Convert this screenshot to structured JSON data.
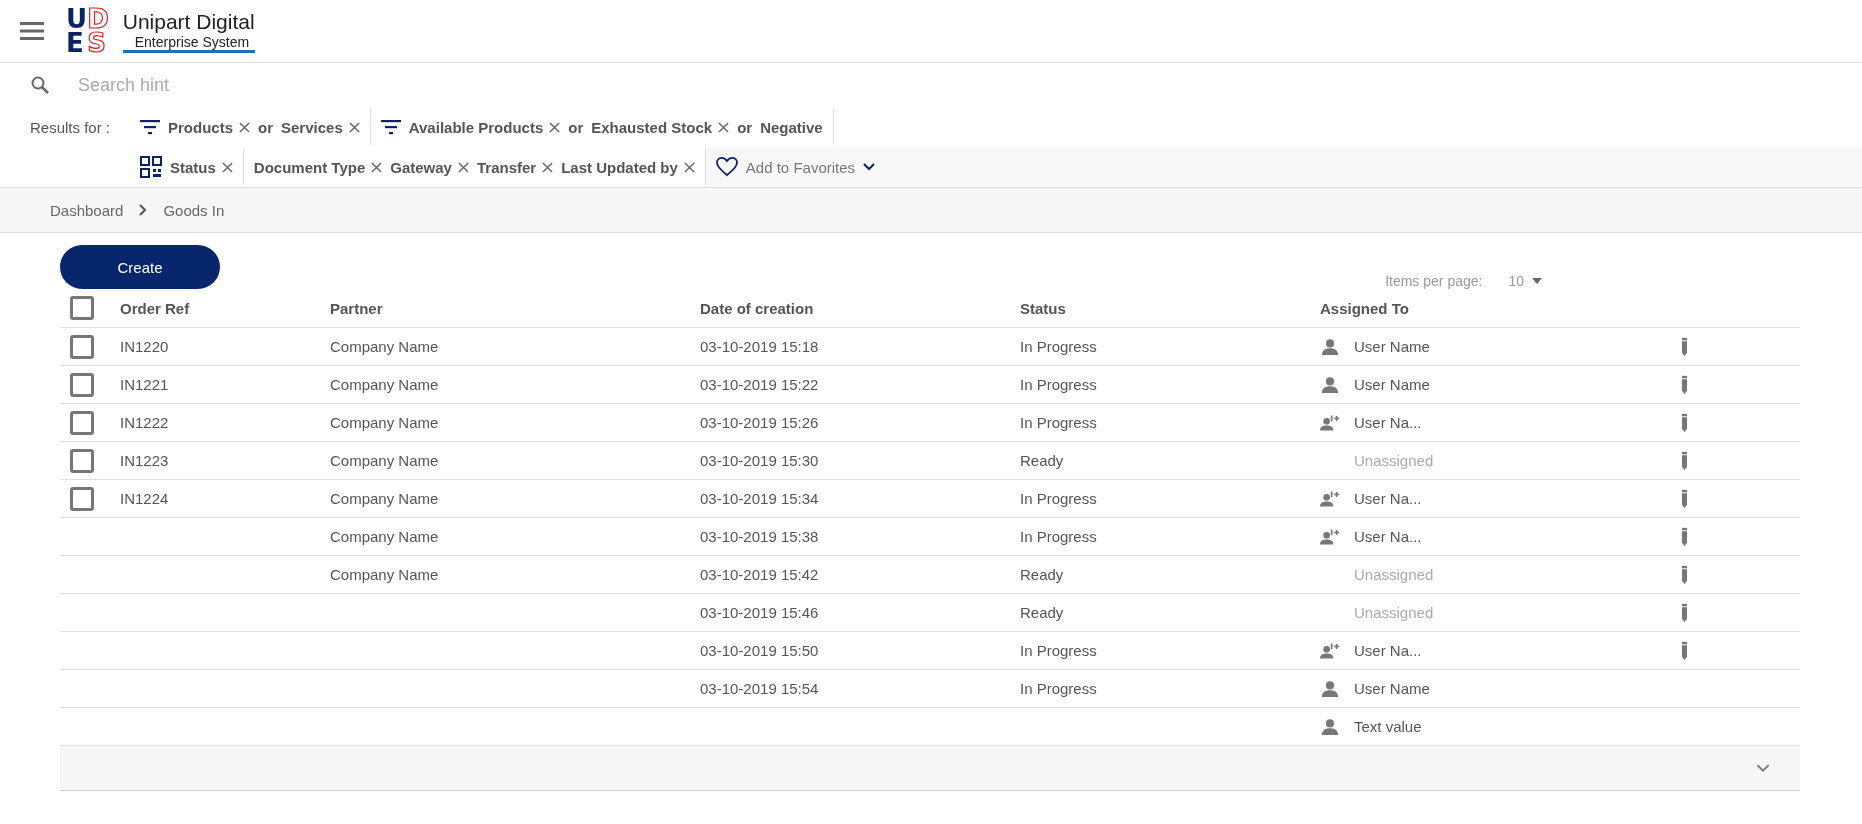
{
  "header": {
    "logo": {
      "letters": [
        "U",
        "D",
        "E",
        "S"
      ],
      "title": "Unipart Digital",
      "subtitle": "Enterprise System"
    }
  },
  "search": {
    "placeholder": "Search hint"
  },
  "filters": {
    "label": "Results for :",
    "lines": [
      [
        {
          "kind": "filter",
          "items": [
            {
              "kind": "chip",
              "text": "Products"
            },
            {
              "kind": "joiner",
              "text": "or"
            },
            {
              "kind": "chip",
              "text": "Services"
            }
          ]
        },
        {
          "kind": "filter",
          "items": [
            {
              "kind": "chip",
              "text": "Available Products"
            },
            {
              "kind": "joiner",
              "text": "or"
            },
            {
              "kind": "chip",
              "text": "Exhausted Stock"
            },
            {
              "kind": "joiner",
              "text": "or"
            },
            {
              "kind": "term",
              "text": "Negative"
            }
          ]
        }
      ],
      [
        {
          "kind": "status",
          "items": [
            {
              "kind": "chip",
              "text": "Status"
            }
          ]
        },
        {
          "kind": "plain",
          "items": [
            {
              "kind": "chip",
              "text": "Document Type"
            },
            {
              "kind": "chip",
              "text": "Gateway"
            },
            {
              "kind": "chip",
              "text": "Transfer"
            },
            {
              "kind": "chip",
              "text": "Last Updated by"
            }
          ]
        }
      ]
    ],
    "favorites": {
      "label": "Add to Favorites"
    }
  },
  "breadcrumb": [
    "Dashboard",
    "Goods In"
  ],
  "create_button": "Create",
  "pagination": {
    "label": "Items per page:",
    "value": "10"
  },
  "table": {
    "header_checked": false,
    "columns": [
      "Order Ref",
      "Partner",
      "Date of creation",
      "Status",
      "Assigned To"
    ],
    "rows": [
      {
        "checked": false,
        "order_ref": "IN1220",
        "partner": "Company Name",
        "date": "03-10-2019 15:18",
        "status": "In Progress",
        "assignee": {
          "kind": "user",
          "text": "User Name"
        },
        "editable": true
      },
      {
        "checked": false,
        "order_ref": "IN1221",
        "partner": "Company Name",
        "date": "03-10-2019 15:22",
        "status": "In Progress",
        "assignee": {
          "kind": "user",
          "text": "User Name"
        },
        "editable": true
      },
      {
        "checked": false,
        "order_ref": "IN1222",
        "partner": "Company Name",
        "date": "03-10-2019 15:26",
        "status": "In Progress",
        "assignee": {
          "kind": "group",
          "text": "User Na..."
        },
        "editable": true
      },
      {
        "checked": false,
        "order_ref": "IN1223",
        "partner": "Company Name",
        "date": "03-10-2019 15:30",
        "status": "Ready",
        "assignee": {
          "kind": "unassigned",
          "text": "Unassigned"
        },
        "editable": true
      },
      {
        "checked": false,
        "order_ref": "IN1224",
        "partner": "Company Name",
        "date": "03-10-2019 15:34",
        "status": "In Progress",
        "assignee": {
          "kind": "group",
          "text": "User Na..."
        },
        "editable": true
      },
      {
        "partner": "Company Name",
        "date": "03-10-2019 15:38",
        "status": "In Progress",
        "assignee": {
          "kind": "group",
          "text": "User Na..."
        },
        "editable": true
      },
      {
        "partner": "Company Name",
        "date": "03-10-2019 15:42",
        "status": "Ready",
        "assignee": {
          "kind": "unassigned",
          "text": "Unassigned"
        },
        "editable": true
      },
      {
        "date": "03-10-2019 15:46",
        "status": "Ready",
        "assignee": {
          "kind": "unassigned",
          "text": "Unassigned"
        },
        "editable": true
      },
      {
        "date": "03-10-2019 15:50",
        "status": "In Progress",
        "assignee": {
          "kind": "group",
          "text": "User Na..."
        },
        "editable": true
      },
      {
        "date": "03-10-2019 15:54",
        "status": "In Progress",
        "assignee": {
          "kind": "user",
          "text": "User Name"
        },
        "editable": false
      },
      {
        "assignee": {
          "kind": "user",
          "text": "Text value"
        },
        "editable": false
      }
    ]
  }
}
